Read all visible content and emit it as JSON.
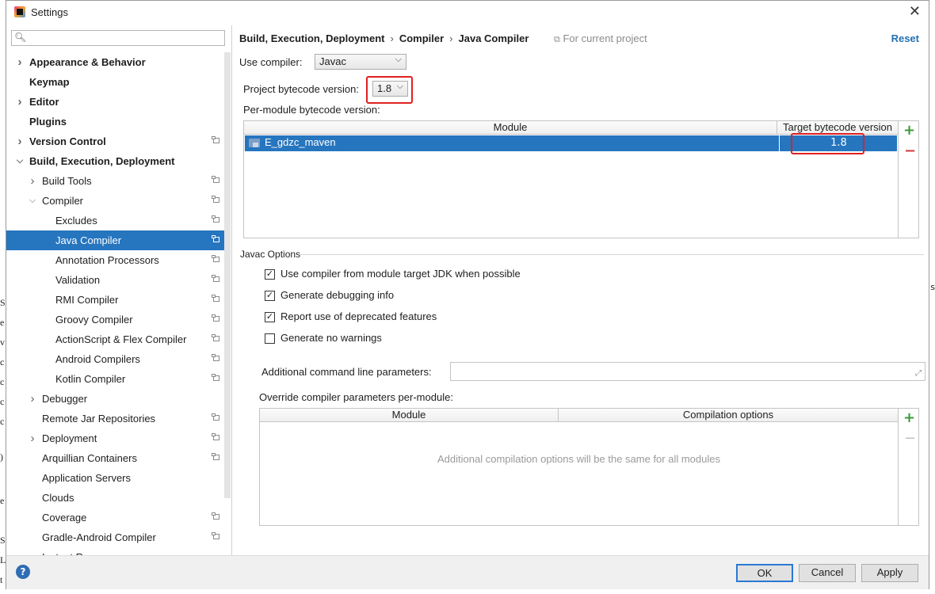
{
  "window": {
    "title": "Settings",
    "close_glyph": "✕"
  },
  "behind": {
    "left_glyphs": [
      "S",
      "e",
      "v",
      "c",
      "c",
      "c",
      "c",
      ")",
      "e",
      "S",
      "L",
      "t"
    ],
    "right_glyphs": [
      "s"
    ]
  },
  "sidebar": {
    "search": {
      "value": "",
      "placeholder": ""
    },
    "items": [
      {
        "label": "Appearance & Behavior",
        "level": 0,
        "bold": true,
        "arrow": "right",
        "proj": false,
        "selected": false
      },
      {
        "label": "Keymap",
        "level": 0,
        "bold": true,
        "arrow": "",
        "proj": false,
        "selected": false
      },
      {
        "label": "Editor",
        "level": 0,
        "bold": true,
        "arrow": "right",
        "proj": false,
        "selected": false
      },
      {
        "label": "Plugins",
        "level": 0,
        "bold": true,
        "arrow": "",
        "proj": false,
        "selected": false
      },
      {
        "label": "Version Control",
        "level": 0,
        "bold": true,
        "arrow": "right",
        "proj": true,
        "selected": false
      },
      {
        "label": "Build, Execution, Deployment",
        "level": 0,
        "bold": true,
        "arrow": "down",
        "proj": false,
        "selected": false
      },
      {
        "label": "Build Tools",
        "level": 1,
        "bold": false,
        "arrow": "right",
        "proj": true,
        "selected": false
      },
      {
        "label": "Compiler",
        "level": 1,
        "bold": false,
        "arrow": "down",
        "proj": true,
        "selected": false
      },
      {
        "label": "Excludes",
        "level": 2,
        "bold": false,
        "arrow": "",
        "proj": true,
        "selected": false
      },
      {
        "label": "Java Compiler",
        "level": 2,
        "bold": false,
        "arrow": "",
        "proj": true,
        "selected": true
      },
      {
        "label": "Annotation Processors",
        "level": 2,
        "bold": false,
        "arrow": "",
        "proj": true,
        "selected": false
      },
      {
        "label": "Validation",
        "level": 2,
        "bold": false,
        "arrow": "",
        "proj": true,
        "selected": false
      },
      {
        "label": "RMI Compiler",
        "level": 2,
        "bold": false,
        "arrow": "",
        "proj": true,
        "selected": false
      },
      {
        "label": "Groovy Compiler",
        "level": 2,
        "bold": false,
        "arrow": "",
        "proj": true,
        "selected": false
      },
      {
        "label": "ActionScript & Flex Compiler",
        "level": 2,
        "bold": false,
        "arrow": "",
        "proj": true,
        "selected": false
      },
      {
        "label": "Android Compilers",
        "level": 2,
        "bold": false,
        "arrow": "",
        "proj": true,
        "selected": false
      },
      {
        "label": "Kotlin Compiler",
        "level": 2,
        "bold": false,
        "arrow": "",
        "proj": true,
        "selected": false
      },
      {
        "label": "Debugger",
        "level": 1,
        "bold": false,
        "arrow": "right",
        "proj": false,
        "selected": false
      },
      {
        "label": "Remote Jar Repositories",
        "level": 1,
        "bold": false,
        "arrow": "",
        "proj": true,
        "selected": false
      },
      {
        "label": "Deployment",
        "level": 1,
        "bold": false,
        "arrow": "right",
        "proj": true,
        "selected": false
      },
      {
        "label": "Arquillian Containers",
        "level": 1,
        "bold": false,
        "arrow": "",
        "proj": true,
        "selected": false
      },
      {
        "label": "Application Servers",
        "level": 1,
        "bold": false,
        "arrow": "",
        "proj": false,
        "selected": false
      },
      {
        "label": "Clouds",
        "level": 1,
        "bold": false,
        "arrow": "",
        "proj": false,
        "selected": false
      },
      {
        "label": "Coverage",
        "level": 1,
        "bold": false,
        "arrow": "",
        "proj": true,
        "selected": false
      },
      {
        "label": "Gradle-Android Compiler",
        "level": 1,
        "bold": false,
        "arrow": "",
        "proj": true,
        "selected": false
      },
      {
        "label": "Instant Run",
        "level": 1,
        "bold": false,
        "arrow": "",
        "proj": false,
        "selected": false
      }
    ]
  },
  "main": {
    "breadcrumb": [
      "Build, Execution, Deployment",
      "Compiler",
      "Java Compiler"
    ],
    "breadcrumb_sep": "›",
    "for_current_project": "For current project",
    "reset_label": "Reset",
    "use_compiler_label": "Use compiler:",
    "use_compiler_value": "Javac",
    "project_bytecode_label": "Project bytecode version:",
    "project_bytecode_value": "1.8",
    "per_module_label": "Per-module bytecode version:",
    "module_table": {
      "headers": [
        "Module",
        "Target bytecode version"
      ],
      "rows": [
        {
          "module": "E_gdzc_maven",
          "target": "1.8"
        }
      ]
    },
    "javac_options_label": "Javac Options",
    "checkboxes": [
      {
        "label": "Use compiler from module target JDK when possible",
        "checked": true
      },
      {
        "label": "Generate debugging info",
        "checked": true
      },
      {
        "label": "Report use of deprecated features",
        "checked": true
      },
      {
        "label": "Generate no warnings",
        "checked": false
      }
    ],
    "additional_params_label": "Additional command line parameters:",
    "additional_params_value": "",
    "override_label": "Override compiler parameters per-module:",
    "override_table": {
      "headers": [
        "Module",
        "Compilation options"
      ],
      "empty_text": "Additional compilation options will be the same for all modules"
    },
    "plus_glyph": "+",
    "minus_glyph": "−"
  },
  "footer": {
    "help": "?",
    "ok": "OK",
    "cancel": "Cancel",
    "apply": "Apply"
  },
  "colors": {
    "selection": "#2675bf",
    "highlight_box": "#e02020",
    "link": "#2470b3"
  }
}
